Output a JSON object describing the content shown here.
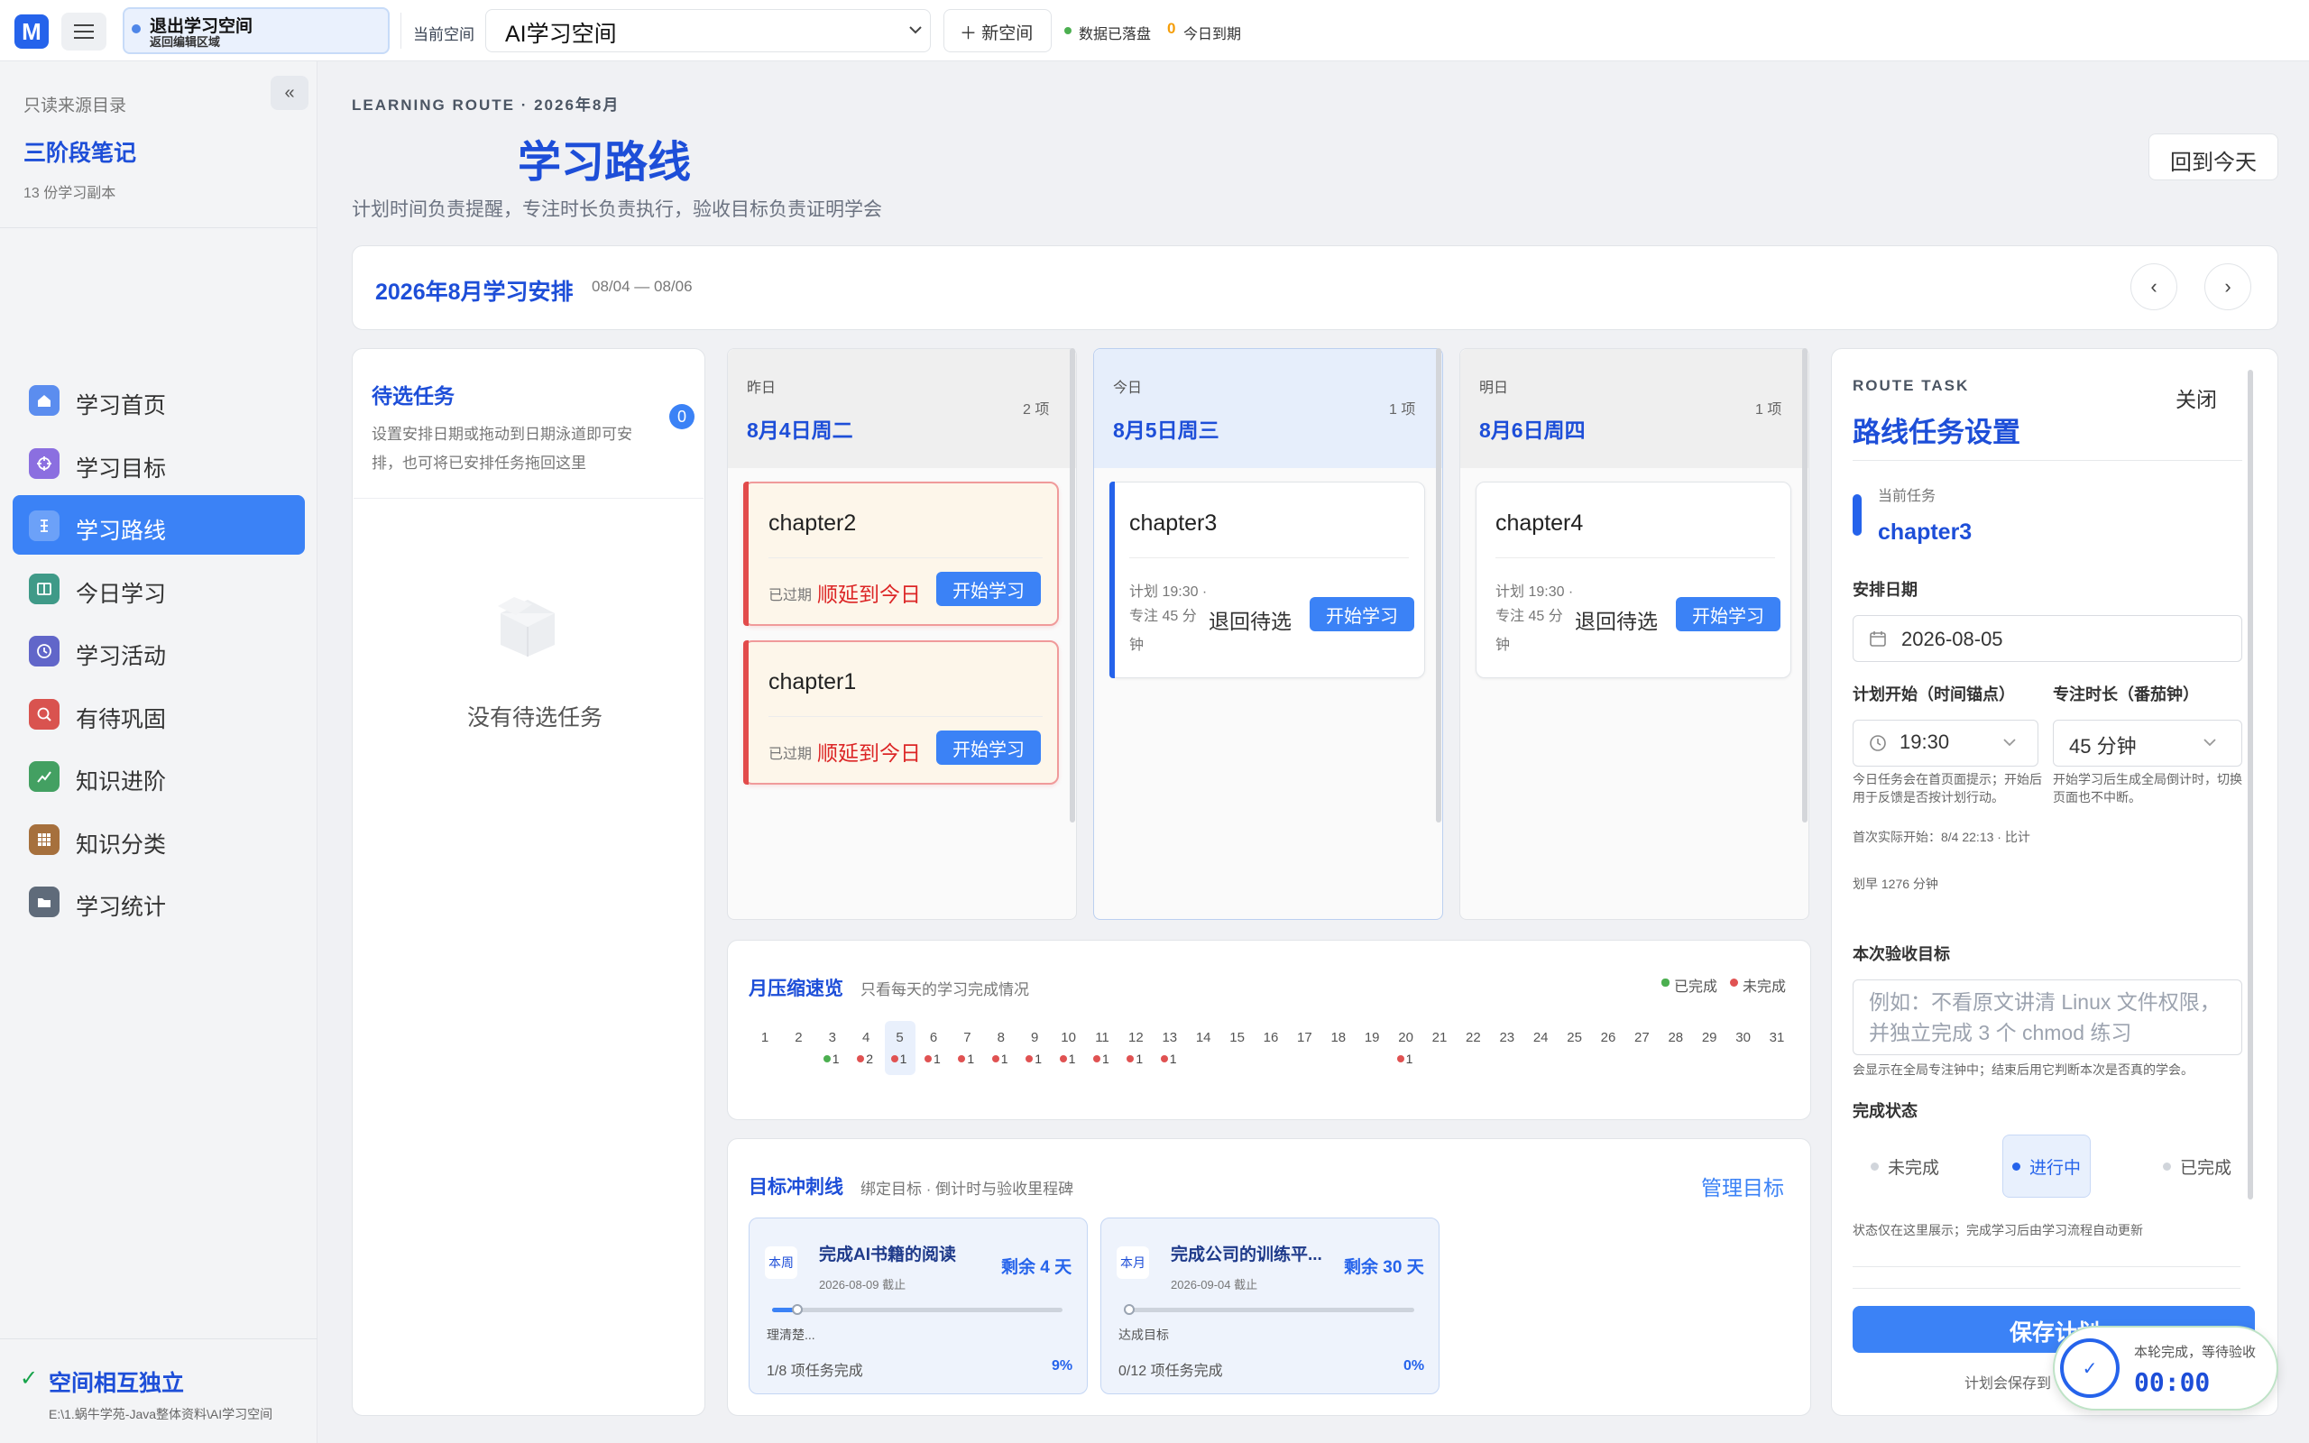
{
  "topbar": {
    "logo_letter": "M",
    "exit_label": "退出学习空间",
    "exit_sub": "返回编辑区域",
    "current_space_label": "当前空间",
    "space_name": "AI学习空间",
    "new_space": "＋ 新空间",
    "sync_status": "数据已落盘",
    "due_count": "0",
    "due_label": "今日到期"
  },
  "sidebar": {
    "source_label": "只读来源目录",
    "book_title": "三阶段笔记",
    "copies": "13 份学习副本",
    "items": [
      {
        "label": "学习首页",
        "icon": "home-icon",
        "color": "#5b8def"
      },
      {
        "label": "学习目标",
        "icon": "target-icon",
        "color": "#8b6fe0"
      },
      {
        "label": "学习路线",
        "icon": "route-icon",
        "color": "#5b8def"
      },
      {
        "label": "今日学习",
        "icon": "book-icon",
        "color": "#3f9a88"
      },
      {
        "label": "学习活动",
        "icon": "clock-icon",
        "color": "#6166c9"
      },
      {
        "label": "有待巩固",
        "icon": "search-icon",
        "color": "#d9534f"
      },
      {
        "label": "知识进阶",
        "icon": "chart-icon",
        "color": "#43a062"
      },
      {
        "label": "知识分类",
        "icon": "grid-icon",
        "color": "#a6703d"
      },
      {
        "label": "学习统计",
        "icon": "folder-icon",
        "color": "#5f6b7a"
      }
    ],
    "footer_title": "空间相互独立",
    "footer_path": "E:\\1.蜗牛学苑-Java整体资料\\AI学习空间"
  },
  "header": {
    "eyebrow": "LEARNING ROUTE · 2026年8月",
    "title": "学习路线",
    "subtitle": "计划时间负责提醒，专注时长负责执行，验收目标负责证明学会",
    "back_today": "回到今天"
  },
  "week": {
    "title": "2026年8月学习安排",
    "range": "08/04 — 08/06",
    "prev": "‹",
    "next": "›"
  },
  "pending": {
    "title": "待选任务",
    "desc": "设置安排日期或拖动到日期泳道即可安排，也可将已安排任务拖回这里",
    "count": "0",
    "empty": "没有待选任务"
  },
  "days": [
    {
      "tag": "昨日",
      "name": "8月4日周二",
      "count": "2 项",
      "cards": [
        {
          "title": "chapter2",
          "status": "已过期",
          "action": "顺延到今日",
          "start": "开始学习"
        },
        {
          "title": "chapter1",
          "status": "已过期",
          "action": "顺延到今日",
          "start": "开始学习"
        }
      ]
    },
    {
      "tag": "今日",
      "name": "8月5日周三",
      "count": "1 项",
      "cards": [
        {
          "title": "chapter3",
          "plan": "计划 19:30 ·",
          "focus": "专注 45 分钟",
          "action": "退回待选",
          "start": "开始学习"
        }
      ]
    },
    {
      "tag": "明日",
      "name": "8月6日周四",
      "count": "1 项",
      "cards": [
        {
          "title": "chapter4",
          "plan": "计划 19:30 ·",
          "focus": "专注 45 分钟",
          "action": "退回待选",
          "start": "开始学习"
        }
      ]
    }
  ],
  "month": {
    "title": "月压缩速览",
    "desc": "只看每天的学习完成情况",
    "legend_done": "已完成",
    "legend_undone": "未完成",
    "today": 5,
    "days": [
      {
        "d": 1
      },
      {
        "d": 2
      },
      {
        "d": 3,
        "done": 1
      },
      {
        "d": 4,
        "undone": 2
      },
      {
        "d": 5,
        "undone": 1
      },
      {
        "d": 6,
        "undone": 1
      },
      {
        "d": 7,
        "undone": 1
      },
      {
        "d": 8,
        "undone": 1
      },
      {
        "d": 9,
        "undone": 1
      },
      {
        "d": 10,
        "undone": 1
      },
      {
        "d": 11,
        "undone": 1
      },
      {
        "d": 12,
        "undone": 1
      },
      {
        "d": 13,
        "undone": 1
      },
      {
        "d": 14
      },
      {
        "d": 15
      },
      {
        "d": 16
      },
      {
        "d": 17
      },
      {
        "d": 18
      },
      {
        "d": 19
      },
      {
        "d": 20,
        "undone": 1
      },
      {
        "d": 21
      },
      {
        "d": 22
      },
      {
        "d": 23
      },
      {
        "d": 24
      },
      {
        "d": 25
      },
      {
        "d": 26
      },
      {
        "d": 27
      },
      {
        "d": 28
      },
      {
        "d": 29
      },
      {
        "d": 30
      },
      {
        "d": 31
      }
    ]
  },
  "goals": {
    "title": "目标冲刺线",
    "desc": "绑定目标 · 倒计时与验收里程碑",
    "manage": "管理目标",
    "items": [
      {
        "tag": "本周",
        "name": "完成AI书籍的阅读",
        "left": "剩余 4 天",
        "date": "2026-08-09 截止",
        "small": "理清楚...",
        "tasks": "1/8 项任务完成",
        "pct": "9%",
        "progress": 0.09
      },
      {
        "tag": "本月",
        "name": "完成公司的训练平...",
        "left": "剩余 30 天",
        "date": "2026-09-04 截止",
        "small": "达成目标",
        "tasks": "0/12 项任务完成",
        "pct": "0%",
        "progress": 0.0
      }
    ]
  },
  "task": {
    "eyebrow": "ROUTE TASK",
    "close": "关闭",
    "title": "路线任务设置",
    "current_label": "当前任务",
    "current": "chapter3",
    "date_label": "安排日期",
    "date": "2026-08-05",
    "start_label": "计划开始（时间锚点）",
    "start": "19:30",
    "start_hint": "今日任务会在首页面提示；开始后用于反馈是否按计划行动。",
    "dur_label": "专注时长（番茄钟）",
    "dur": "45 分钟",
    "dur_hint": "开始学习后生成全局倒计时，切换页面也不中断。",
    "actual_start": "首次实际开始：8/4 22:13 · 比计",
    "early": "划早 1276 分钟",
    "goal_label": "本次验收目标",
    "goal_placeholder": "例如：不看原文讲清 Linux 文件权限，并独立完成 3 个 chmod 练习",
    "goal_hint": "会显示在全局专注钟中；结束后用它判断本次是否真的学会。",
    "status_label": "完成状态",
    "status": [
      "未完成",
      "进行中",
      "已完成"
    ],
    "status_hint": "状态仅在这里展示；完成学习后由学习流程自动更新",
    "save": "保存计划",
    "save_hint": "计划会保存到"
  },
  "timer": {
    "label": "本轮完成，等待验收",
    "time": "00:00"
  },
  "colors": {
    "accent": "#2563eb",
    "button": "#3b82f6",
    "done": "#4caf50",
    "undone": "#e05252"
  }
}
